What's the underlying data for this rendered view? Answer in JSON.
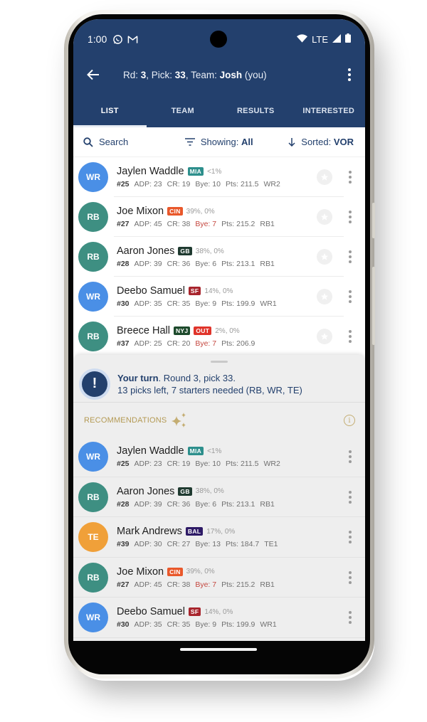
{
  "status_bar": {
    "time": "1:00",
    "left_icons": [
      "whatsapp-icon",
      "gmail-icon"
    ],
    "network": "LTE",
    "right_icons": [
      "wifi-icon",
      "signal-icon",
      "battery-icon"
    ]
  },
  "header": {
    "title_parts": {
      "rd_label": "Rd: ",
      "rd_value": "3",
      "pick_label": ", Pick: ",
      "pick_value": "33",
      "team_label": ", Team: ",
      "team_value": "Josh",
      "team_suffix": " (you)"
    }
  },
  "tabs": [
    {
      "label": "LIST",
      "active": true
    },
    {
      "label": "TEAM",
      "active": false
    },
    {
      "label": "RESULTS",
      "active": false
    },
    {
      "label": "INTERESTED",
      "active": false
    }
  ],
  "toolbar": {
    "search_label": "Search",
    "showing_label": "Showing:",
    "showing_value": "All",
    "sorted_label": "Sorted:",
    "sorted_value": "VOR"
  },
  "colors": {
    "primary": "#23406d",
    "wr": "#4a8fe6",
    "rb": "#3e8f82",
    "te": "#f0a039",
    "warn": "#c4463e",
    "gold": "#b49a54"
  },
  "players": [
    {
      "pos": "WR",
      "name": "Jaylen Waddle",
      "team": "MIA",
      "team_color": "#2d8f8c",
      "out": false,
      "pct": "<1%",
      "rank": "#25",
      "adp": "ADP: 23",
      "cr": "CR: 19",
      "bye": "Bye: 10",
      "bye_warn": false,
      "pts": "Pts: 211.5",
      "pos_rank": "WR2"
    },
    {
      "pos": "RB",
      "name": "Joe Mixon",
      "team": "CIN",
      "team_color": "#e9582b",
      "out": false,
      "pct": "39%, 0%",
      "rank": "#27",
      "adp": "ADP: 45",
      "cr": "CR: 38",
      "bye": "Bye: 7",
      "bye_warn": true,
      "pts": "Pts: 215.2",
      "pos_rank": "RB1"
    },
    {
      "pos": "RB",
      "name": "Aaron Jones",
      "team": "GB",
      "team_color": "#1f3a30",
      "out": false,
      "pct": "38%, 0%",
      "rank": "#28",
      "adp": "ADP: 39",
      "cr": "CR: 36",
      "bye": "Bye: 6",
      "bye_warn": false,
      "pts": "Pts: 213.1",
      "pos_rank": "RB1"
    },
    {
      "pos": "WR",
      "name": "Deebo Samuel",
      "team": "SF",
      "team_color": "#a8252d",
      "out": false,
      "pct": "14%, 0%",
      "rank": "#30",
      "adp": "ADP: 35",
      "cr": "CR: 35",
      "bye": "Bye: 9",
      "bye_warn": false,
      "pts": "Pts: 199.9",
      "pos_rank": "WR1"
    },
    {
      "pos": "RB",
      "name": "Breece Hall",
      "team": "NYJ",
      "team_color": "#1d4a2c",
      "out": true,
      "out_label": "OUT",
      "pct": "2%, 0%",
      "rank": "#37",
      "adp": "ADP: 25",
      "cr": "CR: 20",
      "bye": "Bye: 7",
      "bye_warn": true,
      "pts": "Pts: 206.9",
      "pos_rank": ""
    }
  ],
  "turn_banner": {
    "bold": "Your turn",
    "line1_rest": ". Round 3, pick 33.",
    "line2": "13 picks left, 7 starters needed (RB, WR, TE)"
  },
  "recommendations": {
    "label": "RECOMMENDATIONS",
    "info_glyph": "i",
    "players": [
      {
        "pos": "WR",
        "name": "Jaylen Waddle",
        "team": "MIA",
        "team_color": "#2d8f8c",
        "pct": "<1%",
        "rank": "#25",
        "adp": "ADP: 23",
        "cr": "CR: 19",
        "bye": "Bye: 10",
        "bye_warn": false,
        "pts": "Pts: 211.5",
        "pos_rank": "WR2"
      },
      {
        "pos": "RB",
        "name": "Aaron Jones",
        "team": "GB",
        "team_color": "#1f3a30",
        "pct": "38%, 0%",
        "rank": "#28",
        "adp": "ADP: 39",
        "cr": "CR: 36",
        "bye": "Bye: 6",
        "bye_warn": false,
        "pts": "Pts: 213.1",
        "pos_rank": "RB1"
      },
      {
        "pos": "TE",
        "name": "Mark Andrews",
        "team": "BAL",
        "team_color": "#2e1a66",
        "pct": "17%, 0%",
        "rank": "#39",
        "adp": "ADP: 30",
        "cr": "CR: 27",
        "bye": "Bye: 13",
        "bye_warn": false,
        "pts": "Pts: 184.7",
        "pos_rank": "TE1"
      },
      {
        "pos": "RB",
        "name": "Joe Mixon",
        "team": "CIN",
        "team_color": "#e9582b",
        "pct": "39%, 0%",
        "rank": "#27",
        "adp": "ADP: 45",
        "cr": "CR: 38",
        "bye": "Bye: 7",
        "bye_warn": true,
        "pts": "Pts: 215.2",
        "pos_rank": "RB1"
      },
      {
        "pos": "WR",
        "name": "Deebo Samuel",
        "team": "SF",
        "team_color": "#a8252d",
        "pct": "14%, 0%",
        "rank": "#30",
        "adp": "ADP: 35",
        "cr": "CR: 35",
        "bye": "Bye: 9",
        "bye_warn": false,
        "pts": "Pts: 199.9",
        "pos_rank": "WR1"
      }
    ]
  }
}
